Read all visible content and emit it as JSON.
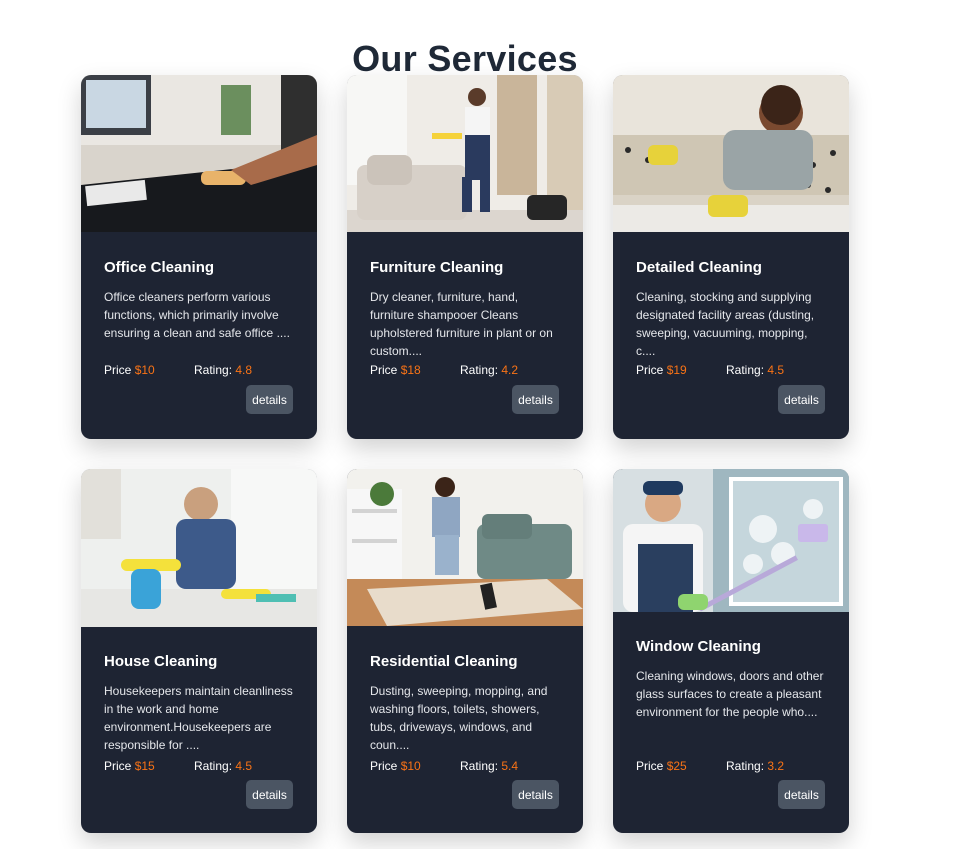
{
  "page": {
    "title": "Our Services"
  },
  "services": [
    {
      "title": "Office Cleaning",
      "description": "Office cleaners perform various functions, which primarily involve ensuring a clean and safe office ....",
      "price_label": "Price",
      "price": "$10",
      "rating_label": "Rating:",
      "rating": "4.8",
      "button": "details"
    },
    {
      "title": "Furniture Cleaning",
      "description": "Dry cleaner, furniture, hand, furniture shampooer Cleans upholstered furniture in plant or on custom....",
      "price_label": "Price",
      "price": "$18",
      "rating_label": "Rating:",
      "rating": "4.2",
      "button": "details"
    },
    {
      "title": "Detailed Cleaning",
      "description": "Cleaning, stocking and supplying designated facility areas (dusting, sweeping, vacuuming, mopping, c....",
      "price_label": "Price",
      "price": "$19",
      "rating_label": "Rating:",
      "rating": "4.5",
      "button": "details"
    },
    {
      "title": "House Cleaning",
      "description": "Housekeepers maintain cleanliness in the work and home environment.Housekeepers are responsible for ....",
      "price_label": "Price",
      "price": "$15",
      "rating_label": "Rating:",
      "rating": "4.5",
      "button": "details"
    },
    {
      "title": "Residential Cleaning",
      "description": "Dusting, sweeping, mopping, and washing floors, toilets, showers, tubs, driveways, windows, and coun....",
      "price_label": "Price",
      "price": "$10",
      "rating_label": "Rating:",
      "rating": "5.4",
      "button": "details"
    },
    {
      "title": "Window Cleaning",
      "description": "Cleaning windows, doors and other glass surfaces to create a pleasant environment for the people who....",
      "price_label": "Price",
      "price": "$25",
      "rating_label": "Rating:",
      "rating": "3.2",
      "button": "details"
    }
  ],
  "colors": {
    "card_background": "#1e2433",
    "accent": "#f97316",
    "button": "#4b5563",
    "heading": "#1f2937"
  }
}
